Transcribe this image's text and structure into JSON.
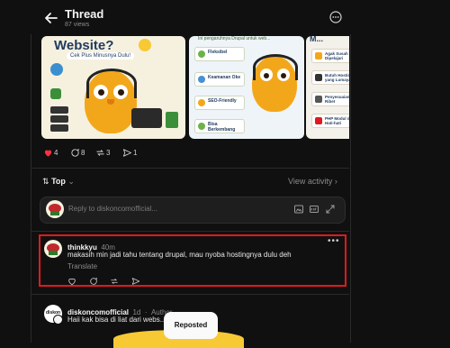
{
  "header": {
    "title": "Thread",
    "views": "87 views"
  },
  "carousel": {
    "card1": {
      "headline": "Website?",
      "subtitle": "Cek Plus Minusnya Dulu!"
    },
    "card2": {
      "header": "Ini pengaruhnya Drupal untuk web...",
      "items": [
        "Fleksibel",
        "Keamanan Oke",
        "SEO-Friendly",
        "Bisa Berkembang"
      ]
    },
    "card3": {
      "header": "M...",
      "items": [
        "Agak Susah Dipelajari",
        "Butuh Hosting yang Lumayan",
        "Penyesuaian Lebih Ribet",
        "PHP Modul dengan Hati-hati"
      ]
    }
  },
  "actions": {
    "likes": "4",
    "comments": "8",
    "reposts": "3",
    "shares": "1"
  },
  "sort": {
    "label": "Top",
    "view_activity": "View activity"
  },
  "reply": {
    "placeholder": "Reply to diskoncomofficial..."
  },
  "comments": [
    {
      "user": "thinkkyu",
      "time": "40m",
      "text": "makasih min jadi tahu tentang drupal, mau nyoba hostingnya dulu deh",
      "translate": "Translate"
    },
    {
      "user": "diskoncomofficial",
      "time": "1d",
      "role": "Author",
      "text": "Haii kak bisa di liat dari webs... ya"
    }
  ],
  "toast": {
    "label": "Reposted"
  },
  "colors": {
    "bg": "#101010",
    "accent_red": "#e0191f",
    "text": "#f3f5f7",
    "muted": "#8a8a8a"
  }
}
